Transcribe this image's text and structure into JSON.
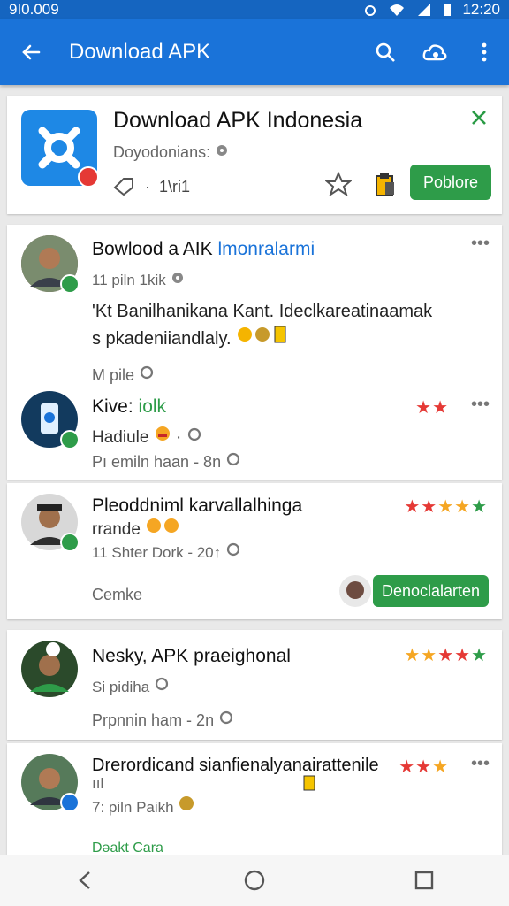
{
  "status_bar": {
    "left_text": "9I0.009",
    "time": "12:20"
  },
  "app_bar": {
    "title": "Download APK"
  },
  "app_card": {
    "title": "Download APK Indonesia",
    "subtitle": "Doyodonians:",
    "meta": "1\\ri1",
    "button": "Poblore"
  },
  "posts": [
    {
      "name": "Bowlood a AIK",
      "name_accent": "lmonralarmi",
      "meta": "11 piln 1kik",
      "body_line1": "'Kt Banilhanikana Kant. Ideclkareatinaamak",
      "body_line2": "s pkadeniiandlaly.",
      "footer": "M pile"
    },
    {
      "name": "Kive:",
      "name_accent": "iolk",
      "meta": "Hadiule",
      "footer": "Pı emiln haan - 8n",
      "stars": "★★"
    },
    {
      "name": "Pleoddniml karvallalhinga",
      "line2": "rrande",
      "meta": "11 Shter Dork - 20↑",
      "footer": "Cemke",
      "button": "Denoclalarten",
      "stars": "★★★★★"
    },
    {
      "name": "Nesky, APK praeighonal",
      "meta": "Si pidiha",
      "footer": "Prpnnin ham - 2n",
      "stars": "★★★★★"
    },
    {
      "name": "Drerordicand sianfienalyanairattenile",
      "name_line2": "ııl",
      "meta": "7: piln Paikh",
      "footer": "Dəakt Cara",
      "stars": "★★★"
    }
  ],
  "colors": {
    "appbar": "#1a73d9",
    "green": "#2e9c49",
    "star_red": "#e53935",
    "star_orange": "#f5a623",
    "star_green": "#2e9c49"
  }
}
